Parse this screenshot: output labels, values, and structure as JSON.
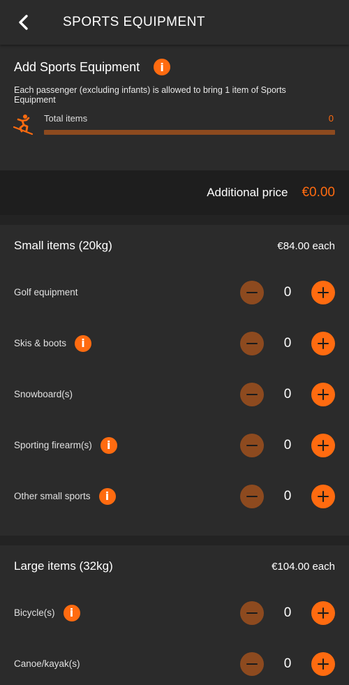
{
  "header": {
    "title": "SPORTS EQUIPMENT",
    "back_icon": "chevron-left-icon"
  },
  "add_section": {
    "title": "Add Sports Equipment",
    "info_icon": "info-icon",
    "description": "Each passenger (excluding infants) is allowed to bring 1 item of Sports Equipment",
    "total_label": "Total items",
    "total_count": "0",
    "progress_fraction": 0,
    "total_icon": "skier-icon"
  },
  "price": {
    "label": "Additional price",
    "amount": "€0.00"
  },
  "colors": {
    "accent": "#ff6b10",
    "accent_muted": "#8d4a1f",
    "background": "#2b2b2b",
    "price_bar": "#1e1e1e"
  },
  "small_items": {
    "title": "Small items (20kg)",
    "price": "€84.00 each",
    "items": [
      {
        "name": "Golf equipment",
        "has_info": false,
        "quantity": "0"
      },
      {
        "name": "Skis & boots",
        "has_info": true,
        "quantity": "0"
      },
      {
        "name": "Snowboard(s)",
        "has_info": false,
        "quantity": "0"
      },
      {
        "name": "Sporting firearm(s)",
        "has_info": true,
        "quantity": "0"
      },
      {
        "name": "Other small sports",
        "has_info": true,
        "quantity": "0"
      }
    ]
  },
  "large_items": {
    "title": "Large items (32kg)",
    "price": "€104.00 each",
    "items": [
      {
        "name": "Bicycle(s)",
        "has_info": true,
        "quantity": "0"
      },
      {
        "name": "Canoe/kayak(s)",
        "has_info": false,
        "quantity": "0"
      }
    ]
  },
  "icons": {
    "info_glyph": "i",
    "minus": "minus-icon",
    "plus": "plus-icon"
  }
}
